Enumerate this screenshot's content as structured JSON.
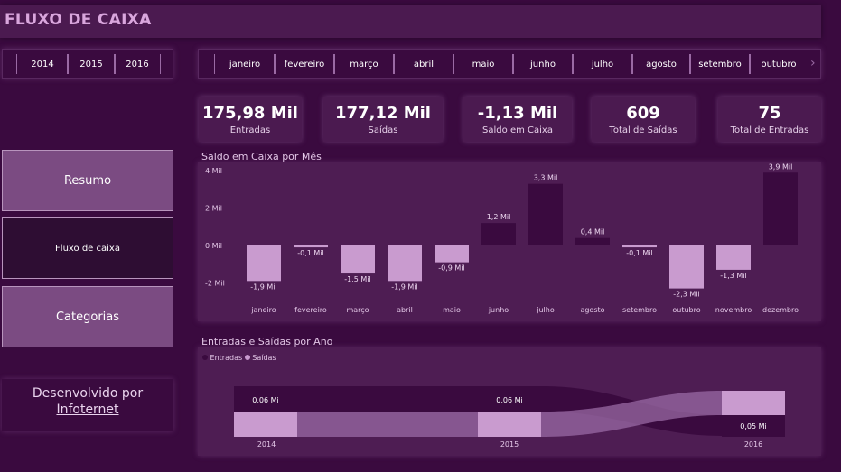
{
  "header": {
    "title": "FLUXO DE CAIXA"
  },
  "years": [
    "2014",
    "2015",
    "2016"
  ],
  "months": [
    "janeiro",
    "fevereiro",
    "março",
    "abril",
    "maio",
    "junho",
    "julho",
    "agosto",
    "setembro",
    "outubro"
  ],
  "kpis": [
    {
      "value": "175,98 Mil",
      "label": "Entradas"
    },
    {
      "value": "177,12 Mil",
      "label": "Saídas"
    },
    {
      "value": "-1,13 Mil",
      "label": "Saldo em Caixa"
    },
    {
      "value": "609",
      "label": "Total de Saídas"
    },
    {
      "value": "75",
      "label": "Total de Entradas"
    }
  ],
  "nav": {
    "resumo": "Resumo",
    "fluxo": "Fluxo de caixa",
    "categorias": "Categorias",
    "dev_prefix": "Desenvolvido por",
    "dev_link": "Infoternet"
  },
  "chart_data": [
    {
      "type": "bar",
      "title": "Saldo em Caixa por Mês",
      "categories": [
        "janeiro",
        "fevereiro",
        "março",
        "abril",
        "maio",
        "junho",
        "julho",
        "agosto",
        "setembro",
        "outubro",
        "novembro",
        "dezembro"
      ],
      "values": [
        -1.9,
        -0.1,
        -1.5,
        -1.9,
        -0.9,
        1.2,
        3.3,
        0.4,
        -0.1,
        -2.3,
        -1.3,
        3.9
      ],
      "labels": [
        "-1,9 Mil",
        "-0,1 Mil",
        "-1,5 Mil",
        "-1,9 Mil",
        "-0,9 Mil",
        "1,2 Mil",
        "3,3 Mil",
        "0,4 Mil",
        "-0,1 Mil",
        "-2,3 Mil",
        "-1,3 Mil",
        "3,9 Mil"
      ],
      "yticks": [
        "4 Mil",
        "2 Mil",
        "0 Mil",
        "-2 Mil"
      ],
      "ylim": [
        -2,
        4
      ]
    },
    {
      "type": "area",
      "title": "Entradas e Saídas por Ano",
      "categories": [
        "2014",
        "2015",
        "2016"
      ],
      "series": [
        {
          "name": "Entradas",
          "labels": [
            "0,06 Mi",
            "0,06 Mi",
            "0,05 Mi"
          ],
          "color": "#3a0a3f"
        },
        {
          "name": "Saídas",
          "color": "#c99bcf"
        }
      ],
      "legend": "top-left"
    }
  ],
  "colors": {
    "neg": "#c99bcf",
    "pos": "#3a0a3f",
    "panel": "#4e1d53"
  }
}
